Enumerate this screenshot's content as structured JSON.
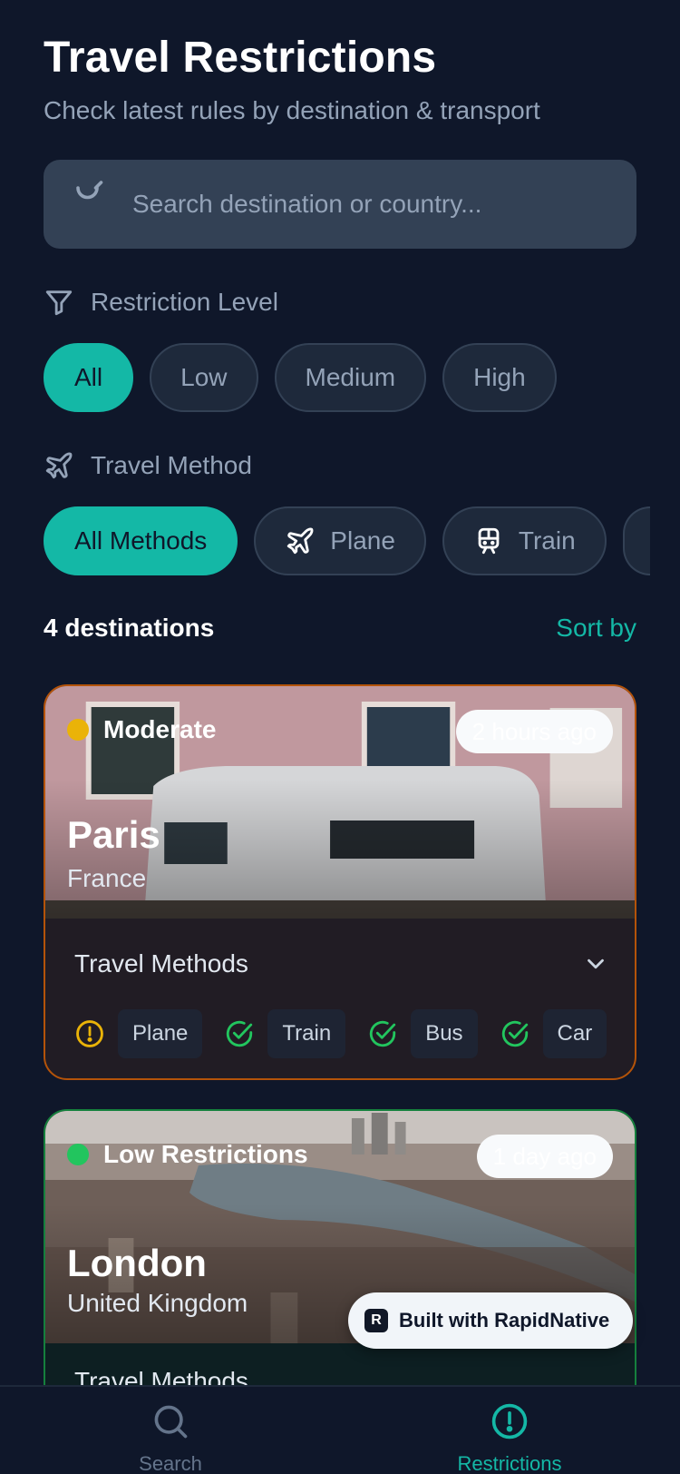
{
  "header": {
    "title": "Travel Restrictions",
    "subtitle": "Check latest rules by destination & transport"
  },
  "search": {
    "placeholder": "Search destination or country..."
  },
  "filters": {
    "restriction_label": "Restriction Level",
    "levels": [
      "All",
      "Low",
      "Medium",
      "High"
    ],
    "active_level": "All",
    "method_label": "Travel Method",
    "methods": [
      "All Methods",
      "Plane",
      "Train"
    ],
    "active_method": "All Methods"
  },
  "results": {
    "count_label": "4 destinations",
    "sort_label": "Sort by"
  },
  "cards": [
    {
      "status_label": "Moderate",
      "status_color": "#eab308",
      "updated": "2 hours ago",
      "city": "Paris",
      "country": "France",
      "methods_title": "Travel Methods",
      "methods": [
        {
          "name": "Plane",
          "state": "warning"
        },
        {
          "name": "Train",
          "state": "open"
        },
        {
          "name": "Bus",
          "state": "open"
        },
        {
          "name": "Car",
          "state": "open"
        }
      ]
    },
    {
      "status_label": "Low Restrictions",
      "status_color": "#22c55e",
      "updated": "1 day ago",
      "city": "London",
      "country": "United Kingdom",
      "methods_title": "Travel Methods"
    }
  ],
  "badge": {
    "label": "Built with RapidNative"
  },
  "tabs": [
    {
      "label": "Search",
      "icon": "search-icon",
      "active": false
    },
    {
      "label": "Restrictions",
      "icon": "alert-circle-icon",
      "active": true
    }
  ],
  "colors": {
    "accent": "#14b8a6",
    "background": "#0f172a",
    "moderate": "#eab308",
    "low": "#22c55e",
    "open": "#22c55e",
    "warning": "#eab308"
  }
}
